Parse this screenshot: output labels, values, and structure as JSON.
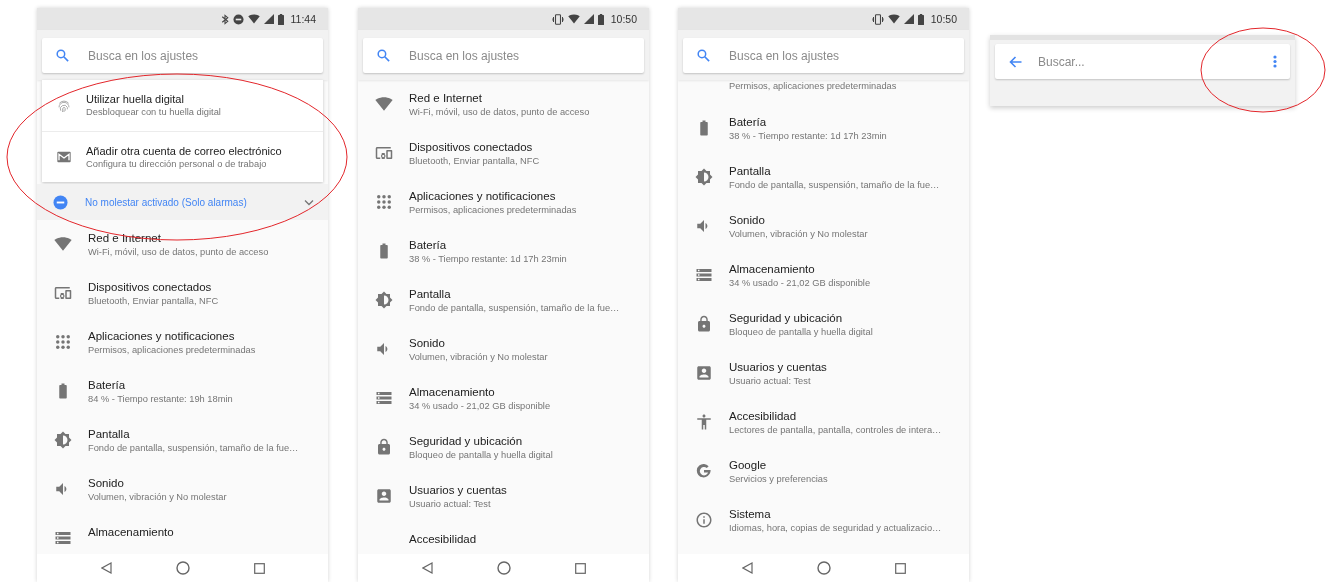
{
  "phones": [
    {
      "kind": "settings",
      "status_bar": {
        "icons": [
          {
            "kind": "bluetooth"
          },
          {
            "kind": "dnd"
          },
          {
            "kind": "wifi"
          },
          {
            "kind": "signal"
          },
          {
            "kind": "battery"
          }
        ],
        "time": "11:44"
      },
      "search": {
        "placeholder": "Busca en los ajustes"
      },
      "suggestions": [
        {
          "kind": "fingerprint",
          "title": "Utilizar huella digital",
          "subtitle": "Desbloquear con tu huella digital"
        },
        {
          "kind": "mail",
          "title": "Añadir otra cuenta de correo electrónico",
          "subtitle": "Configura tu dirección personal o de trabajo"
        }
      ],
      "condition": {
        "text": "No molestar activado (Solo alarmas)",
        "expanded": false
      },
      "items": [
        {
          "kind": "wifi",
          "title": "Red e Internet",
          "subtitle": "Wi-Fi, móvil, uso de datos, punto de acceso"
        },
        {
          "kind": "devices",
          "title": "Dispositivos conectados",
          "subtitle": "Bluetooth, Enviar pantalla, NFC"
        },
        {
          "kind": "apps",
          "title": "Aplicaciones y notificaciones",
          "subtitle": "Permisos, aplicaciones predeterminadas"
        },
        {
          "kind": "battery",
          "title": "Batería",
          "subtitle": "84 % - Tiempo restante: 19h 18min"
        },
        {
          "kind": "display",
          "title": "Pantalla",
          "subtitle": "Fondo de pantalla, suspensión, tamaño de la fue…"
        },
        {
          "kind": "sound",
          "title": "Sonido",
          "subtitle": "Volumen, vibración y No molestar"
        },
        {
          "kind": "storage",
          "title": "Almacenamiento"
        }
      ]
    },
    {
      "kind": "settings",
      "status_bar": {
        "icons": [
          {
            "kind": "vibrate"
          },
          {
            "kind": "wifi"
          },
          {
            "kind": "signal"
          },
          {
            "kind": "battery"
          }
        ],
        "time": "10:50"
      },
      "search": {
        "placeholder": "Busca en los ajustes"
      },
      "items": [
        {
          "kind": "wifi",
          "title": "Red e Internet",
          "subtitle": "Wi-Fi, móvil, uso de datos, punto de acceso"
        },
        {
          "kind": "devices",
          "title": "Dispositivos conectados",
          "subtitle": "Bluetooth, Enviar pantalla, NFC"
        },
        {
          "kind": "apps",
          "title": "Aplicaciones y notificaciones",
          "subtitle": "Permisos, aplicaciones predeterminadas"
        },
        {
          "kind": "battery",
          "title": "Batería",
          "subtitle": "38 % - Tiempo restante: 1d 17h 23min"
        },
        {
          "kind": "display",
          "title": "Pantalla",
          "subtitle": "Fondo de pantalla, suspensión, tamaño de la fue…"
        },
        {
          "kind": "sound",
          "title": "Sonido",
          "subtitle": "Volumen, vibración y No molestar"
        },
        {
          "kind": "storage",
          "title": "Almacenamiento",
          "subtitle": "34 % usado - 21,02 GB disponible"
        },
        {
          "kind": "lock",
          "title": "Seguridad y ubicación",
          "subtitle": "Bloqueo de pantalla y huella digital"
        },
        {
          "kind": "account",
          "title": "Usuarios y cuentas",
          "subtitle": "Usuario actual: Test"
        },
        {
          "title": "Accesibilidad"
        }
      ]
    },
    {
      "kind": "settings",
      "status_bar": {
        "icons": [
          {
            "kind": "vibrate"
          },
          {
            "kind": "wifi"
          },
          {
            "kind": "signal"
          },
          {
            "kind": "battery"
          }
        ],
        "time": "10:50"
      },
      "search": {
        "placeholder": "Busca en los ajustes"
      },
      "items": [
        {
          "subtitle": "Permisos, aplicaciones predeterminadas"
        },
        {
          "kind": "battery",
          "title": "Batería",
          "subtitle": "38 % - Tiempo restante: 1d 17h 23min"
        },
        {
          "kind": "display",
          "title": "Pantalla",
          "subtitle": "Fondo de pantalla, suspensión, tamaño de la fue…"
        },
        {
          "kind": "sound",
          "title": "Sonido",
          "subtitle": "Volumen, vibración y No molestar"
        },
        {
          "kind": "storage",
          "title": "Almacenamiento",
          "subtitle": "34 % usado - 21,02 GB disponible"
        },
        {
          "kind": "lock",
          "title": "Seguridad y ubicación",
          "subtitle": "Bloqueo de pantalla y huella digital"
        },
        {
          "kind": "account",
          "title": "Usuarios y cuentas",
          "subtitle": "Usuario actual: Test"
        },
        {
          "kind": "accessibility",
          "title": "Accesibilidad",
          "subtitle": "Lectores de pantalla, pantalla, controles de intera…"
        },
        {
          "kind": "google",
          "title": "Google",
          "subtitle": "Servicios y preferencias"
        },
        {
          "kind": "info",
          "title": "Sistema",
          "subtitle": "Idiomas, hora, copias de seguridad y actualizacio…"
        }
      ]
    },
    {
      "kind": "search",
      "search": {
        "placeholder": "Buscar..."
      }
    }
  ]
}
